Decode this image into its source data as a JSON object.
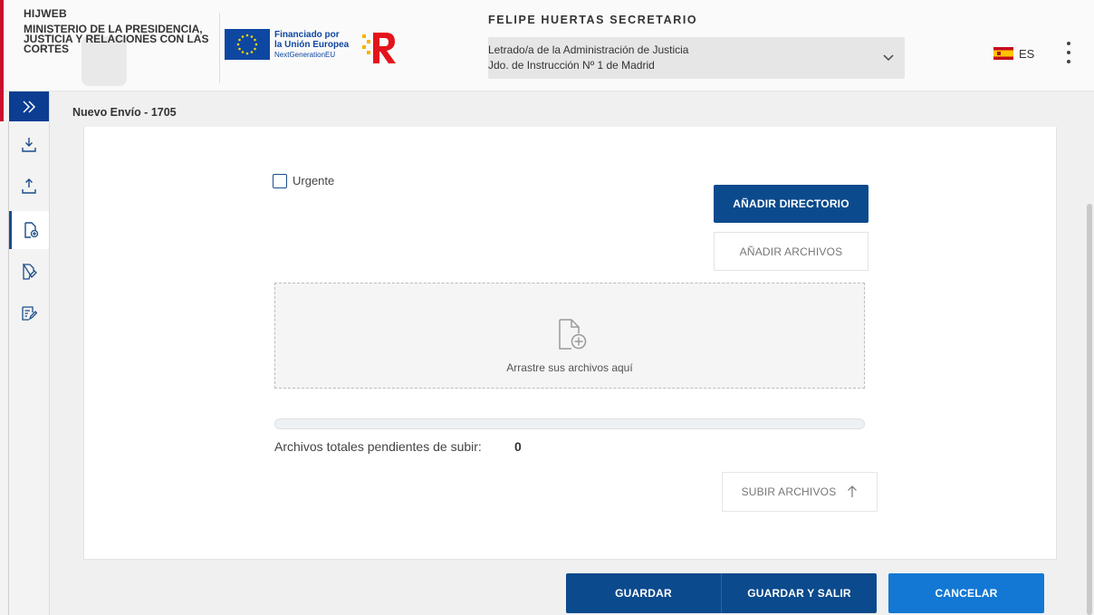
{
  "header": {
    "app_name": "HIJWEB",
    "ministry_lines": [
      "MINISTERIO DE LA PRESIDENCIA,",
      "JUSTICIA Y RELACIONES CON LAS",
      "CORTES"
    ],
    "eu_lines": [
      "Financiado por",
      "la Unión Europea",
      "NextGenerationEU"
    ],
    "user_name": "FELIPE HUERTAS SECRETARIO",
    "role_line1": "Letrado/a de la Administración de Justicia",
    "role_line2": "Jdo. de Instrucción Nº 1 de Madrid",
    "language": "ES"
  },
  "sidebar": {
    "items": [
      {
        "icon": "download-tray-icon"
      },
      {
        "icon": "upload-tray-icon"
      },
      {
        "icon": "new-document-icon",
        "active": true
      },
      {
        "icon": "send-document-icon"
      },
      {
        "icon": "signed-document-icon"
      }
    ]
  },
  "breadcrumb": "Nuevo Envío - 1705",
  "form": {
    "urgent_label": "Urgente",
    "urgent_checked": false,
    "add_directory": "AÑADIR DIRECTORIO",
    "add_files": "AÑADIR ARCHIVOS",
    "drop_text": "Arrastre sus archivos aquí",
    "progress": 0,
    "pending_label": "Archivos totales pendientes de subir:",
    "pending_count": "0",
    "upload_button": "SUBIR ARCHIVOS"
  },
  "actions": {
    "save": "GUARDAR",
    "save_exit": "GUARDAR Y SALIR",
    "cancel": "CANCELAR"
  },
  "colors": {
    "primary": "#0b4a8c",
    "cancel": "#1278d4",
    "accent_red": "#c8102e"
  }
}
